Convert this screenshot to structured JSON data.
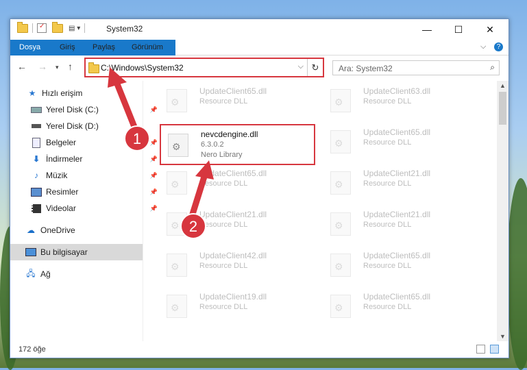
{
  "window": {
    "title": "System32",
    "close_glyph": "✕",
    "max_glyph": "☐",
    "min_glyph": "—"
  },
  "ribbon": {
    "tabs": [
      "Dosya",
      "Giriş",
      "Paylaş",
      "Görünüm"
    ],
    "help": "?",
    "collapse": "⌵"
  },
  "address": {
    "path": "C:\\Windows\\System32",
    "search_placeholder": "Ara: System32"
  },
  "sidebar": {
    "items": [
      {
        "label": "Hızlı erişim",
        "icon": "star-icon"
      },
      {
        "label": "Yerel Disk (C:)",
        "icon": "drive-icon"
      },
      {
        "label": "Yerel Disk (D:)",
        "icon": "drive-icon"
      },
      {
        "label": "Belgeler",
        "icon": "documents-icon"
      },
      {
        "label": "İndirmeler",
        "icon": "download-icon"
      },
      {
        "label": "Müzik",
        "icon": "music-icon"
      },
      {
        "label": "Resimler",
        "icon": "pictures-icon"
      },
      {
        "label": "Videolar",
        "icon": "videos-icon"
      },
      {
        "label": "OneDrive",
        "icon": "cloud-icon"
      },
      {
        "label": "Bu bilgisayar",
        "icon": "computer-icon"
      },
      {
        "label": "Ağ",
        "icon": "network-icon"
      }
    ]
  },
  "files": {
    "highlighted": {
      "name": "nevcdengine.dll",
      "version": "6.3.0.2",
      "desc": "Nero Library"
    },
    "left": [
      {
        "name": "UpdateClient65.dll",
        "desc": "Resource DLL"
      },
      {
        "name": "UpdateClient65.dll",
        "desc": "Resource DLL"
      },
      {
        "name": "UpdateClient21.dll",
        "desc": "Resource DLL"
      },
      {
        "name": "UpdateClient42.dll",
        "desc": "Resource DLL"
      },
      {
        "name": "UpdateClient19.dll",
        "desc": "Resource DLL"
      }
    ],
    "right": [
      {
        "name": "UpdateClient63.dll",
        "desc": "Resource DLL"
      },
      {
        "name": "UpdateClient65.dll",
        "desc": "Resource DLL"
      },
      {
        "name": "UpdateClient21.dll",
        "desc": "Resource DLL"
      },
      {
        "name": "UpdateClient21.dll",
        "desc": "Resource DLL"
      },
      {
        "name": "UpdateClient65.dll",
        "desc": "Resource DLL"
      },
      {
        "name": "UpdateClient65.dll",
        "desc": "Resource DLL"
      }
    ]
  },
  "status": {
    "count": "172 öğe"
  },
  "annotations": {
    "step1": "1",
    "step2": "2",
    "color": "#d7363e"
  }
}
